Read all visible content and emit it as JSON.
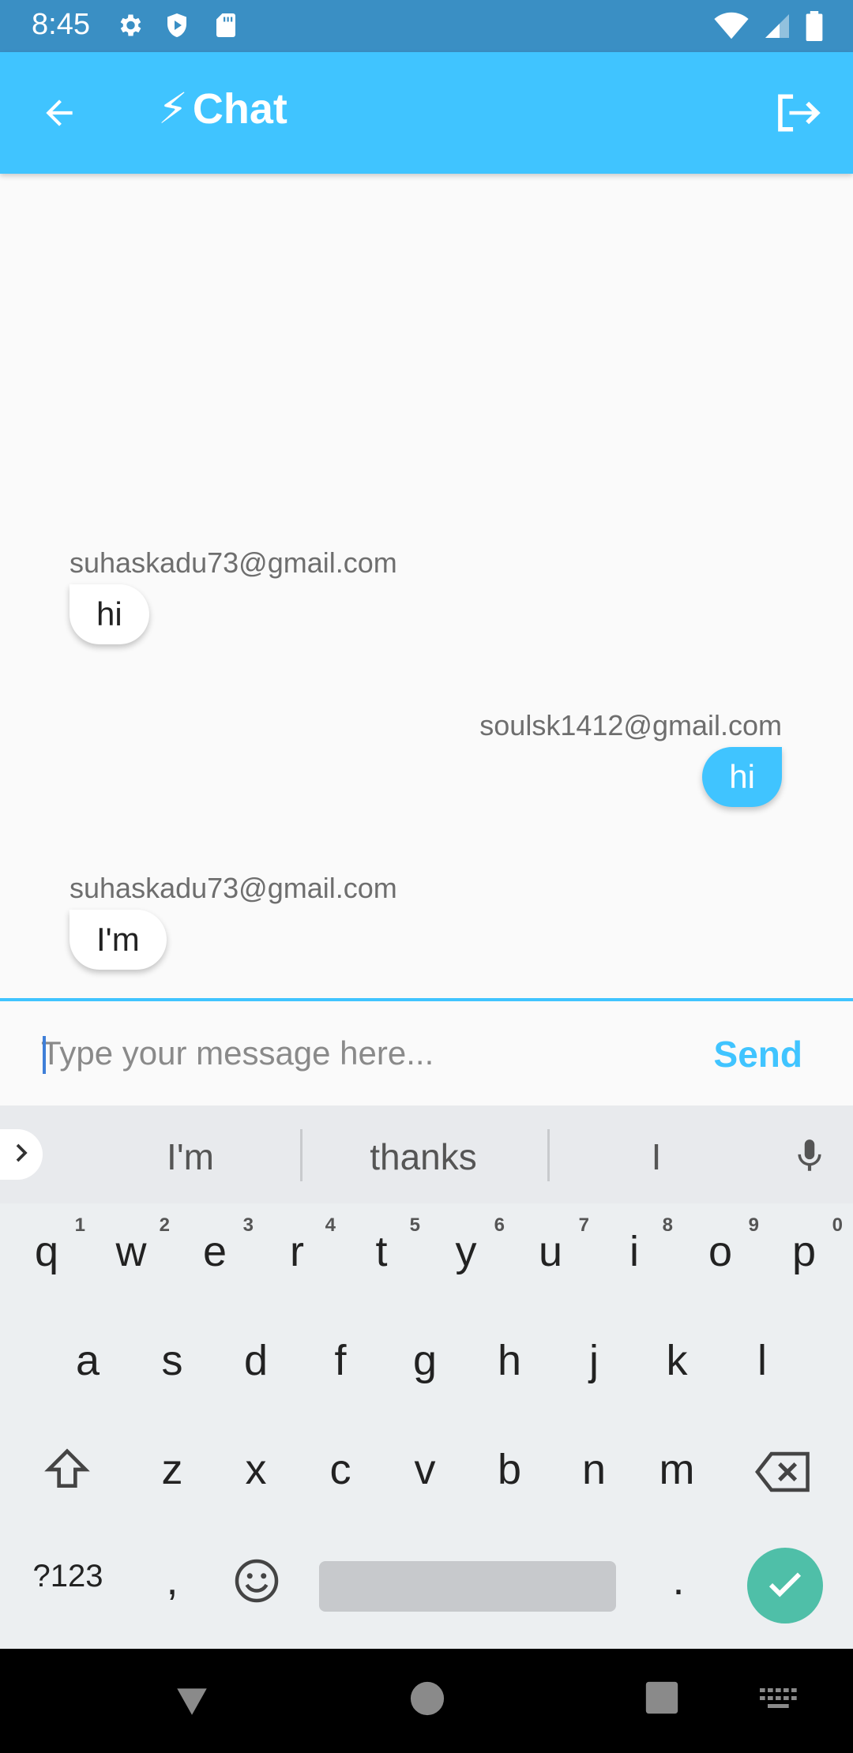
{
  "status_bar": {
    "time": "8:45",
    "icons_left": [
      "settings-icon",
      "shield-play-icon",
      "sd-card-icon"
    ],
    "icons_right": [
      "wifi-icon",
      "signal-icon",
      "battery-icon"
    ]
  },
  "app_bar": {
    "title": "Chat",
    "title_icon": "⚡",
    "back_icon": "arrow-left-icon",
    "logout_icon": "logout-icon"
  },
  "messages": [
    {
      "sender": "suhaskadu73@gmail.com",
      "text": "hi",
      "direction": "incoming"
    },
    {
      "sender": "soulsk1412@gmail.com",
      "text": "hi",
      "direction": "outgoing"
    },
    {
      "sender": "suhaskadu73@gmail.com",
      "text": "I'm",
      "direction": "incoming"
    }
  ],
  "compose": {
    "placeholder": "Type your message here...",
    "value": "",
    "send_label": "Send"
  },
  "keyboard": {
    "suggestions": [
      "I'm",
      "thanks",
      "I"
    ],
    "row1": [
      {
        "k": "q",
        "n": "1"
      },
      {
        "k": "w",
        "n": "2"
      },
      {
        "k": "e",
        "n": "3"
      },
      {
        "k": "r",
        "n": "4"
      },
      {
        "k": "t",
        "n": "5"
      },
      {
        "k": "y",
        "n": "6"
      },
      {
        "k": "u",
        "n": "7"
      },
      {
        "k": "i",
        "n": "8"
      },
      {
        "k": "o",
        "n": "9"
      },
      {
        "k": "p",
        "n": "0"
      }
    ],
    "row2": [
      "a",
      "s",
      "d",
      "f",
      "g",
      "h",
      "j",
      "k",
      "l"
    ],
    "row3": [
      "z",
      "x",
      "c",
      "v",
      "b",
      "n",
      "m"
    ],
    "row4": {
      "symbols": "?123",
      "comma": ",",
      "period": "."
    }
  },
  "colors": {
    "accent": "#40c4ff",
    "status_bar": "#3a8fc4",
    "enter_key": "#4fbfa8"
  }
}
